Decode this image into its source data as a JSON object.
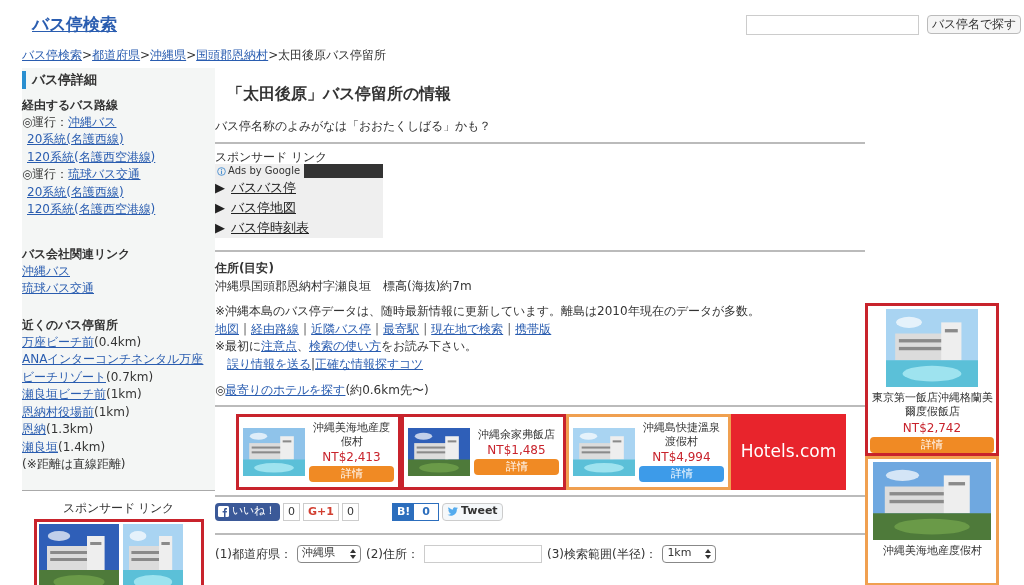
{
  "header": {
    "site_title": "バス停検索",
    "search_button": "バス停名で探す"
  },
  "breadcrumb": [
    {
      "text": "バス停検索",
      "kind": "link"
    },
    {
      "text": ">",
      "kind": "sep"
    },
    {
      "text": "都道府県",
      "kind": "link"
    },
    {
      "text": ">",
      "kind": "sep"
    },
    {
      "text": "沖縄県",
      "kind": "link"
    },
    {
      "text": ">",
      "kind": "sep"
    },
    {
      "text": "国頭郡恩納村",
      "kind": "link"
    },
    {
      "text": ">太田後原バス停留所",
      "kind": "text"
    }
  ],
  "sidebar": {
    "heading": "バス停詳細",
    "routes": {
      "heading": "経由するバス路線",
      "operators": [
        {
          "prefix": "◎運行：",
          "name": "沖縄バス",
          "routes": [
            "20系統(名護西線)",
            "120系統(名護西空港線)"
          ]
        },
        {
          "prefix": "◎運行：",
          "name": "琉球バス交通",
          "routes": [
            "20系統(名護西線)",
            "120系統(名護西空港線)"
          ]
        }
      ]
    },
    "company_links": {
      "heading": "バス会社関連リンク",
      "links": [
        "沖縄バス",
        "琉球バス交通"
      ]
    },
    "nearby": {
      "heading": "近くのバス停留所",
      "stops": [
        {
          "lines": [
            "万座ビーチ前"
          ],
          "distance": "(0.4km)"
        },
        {
          "lines": [
            "ANAインターコンチネンタル万座",
            "ビーチリゾート"
          ],
          "distance": "(0.7km)"
        },
        {
          "lines": [
            "瀬良垣ビーチ前"
          ],
          "distance": "(1km)"
        },
        {
          "lines": [
            "恩納村役場前"
          ],
          "distance": "(1km)"
        },
        {
          "lines": [
            "恩納"
          ],
          "distance": "(1.3km)"
        },
        {
          "lines": [
            "瀬良垣"
          ],
          "distance": "(1.4km)"
        }
      ],
      "note": "(※距離は直線距離)"
    },
    "sponsor_label": "スポンサード リンク"
  },
  "main": {
    "title": "「太田後原」バス停留所の情報",
    "reading": "バス停名称のよみがなは「おおたくしばる」かも？",
    "sponsor_label": "スポンサード リンク",
    "ads_label": "Ads by Google",
    "ad_links": [
      {
        "arrow": "▶",
        "text": "バスバス停"
      },
      {
        "arrow": "▶",
        "text": "バス停地図"
      },
      {
        "arrow": "▶",
        "text": "バス停時刻表"
      }
    ],
    "address_heading": "住所(目安)",
    "address": "沖縄県国頭郡恩納村字瀬良垣　標高(海抜)約7m",
    "notice": "※沖縄本島のバス停データは、随時最新情報に更新しています。離島は2010年現在のデータが多数。",
    "nav_links": [
      "地図",
      "経由路線",
      "近隣バス停",
      "最寄駅",
      "現在地で検索",
      "携帯版"
    ],
    "separator": "|",
    "read_first": [
      {
        "text": "※最初に",
        "kind": "text"
      },
      {
        "text": "注意点",
        "kind": "link"
      },
      {
        "text": "、",
        "kind": "text"
      },
      {
        "text": "検索の使い方",
        "kind": "link"
      },
      {
        "text": "をお読み下さい。",
        "kind": "text"
      }
    ],
    "feedback_links": [
      "誤り情報を送る",
      "正確な情報探すコツ"
    ],
    "hotel_search": {
      "prefix": "◎",
      "link": "最寄りのホテルを探す",
      "suffix": "(約0.6km先〜)"
    },
    "hotel_ads": [
      {
        "name": "沖縄美海地産度假村",
        "price": "NT$2,413",
        "button": "詳情",
        "color": "#f08a24"
      },
      {
        "name": "沖縄余家弗飯店",
        "price": "NT$1,485",
        "button": "詳情",
        "color": "#f08a24"
      },
      {
        "name": "沖縄島快捷溫泉渡假村",
        "price": "NT$4,994",
        "button": "詳情",
        "color": "#3d9be9"
      }
    ],
    "hotels_logo": "Hotels.com",
    "social": {
      "like": "いいね！",
      "like_count": "0",
      "gplus": "G+1",
      "gplus_count": "0",
      "hatena": "B!",
      "hatena_count": "0",
      "tweet": "Tweet"
    },
    "search_form": {
      "pref_label": "(1)都道府県：",
      "pref_value": "沖縄県",
      "address_label": "(2)住所：",
      "range_label": "(3)検索範囲(半径)：",
      "range_value": "1km"
    }
  },
  "right_ads": [
    {
      "name": "東京第一飯店沖縄格蘭美爾度假飯店",
      "price": "NT$2,742",
      "button": "詳情",
      "color": "#f08a24"
    },
    {
      "name": "沖縄美海地産度假村"
    }
  ]
}
